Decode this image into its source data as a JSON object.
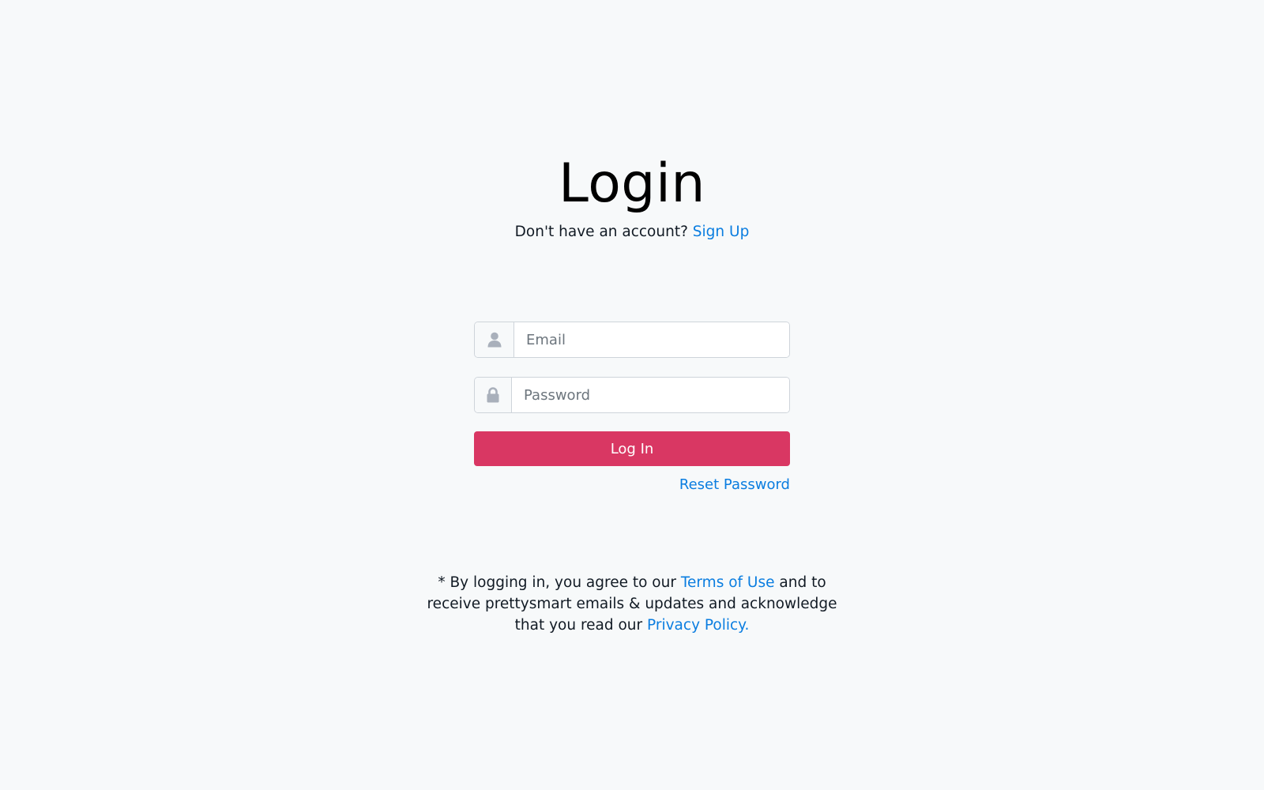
{
  "header": {
    "title": "Login",
    "signup_prompt": "Don't have an account?",
    "signup_link": "Sign Up"
  },
  "form": {
    "email": {
      "placeholder": "Email",
      "value": "",
      "icon": "user-icon"
    },
    "password": {
      "placeholder": "Password",
      "value": "",
      "icon": "lock-icon"
    },
    "submit_label": "Log In",
    "reset_link": "Reset Password"
  },
  "legal": {
    "prefix": "* By logging in, you agree to our",
    "terms_link": "Terms of Use",
    "middle": "and to receive prettysmart emails & updates and acknowledge that you read our",
    "privacy_link": "Privacy Policy."
  },
  "colors": {
    "background": "#f7f9fa",
    "link": "#0a7de0",
    "primary_button": "#d93763",
    "icon": "#a9b0bb"
  }
}
